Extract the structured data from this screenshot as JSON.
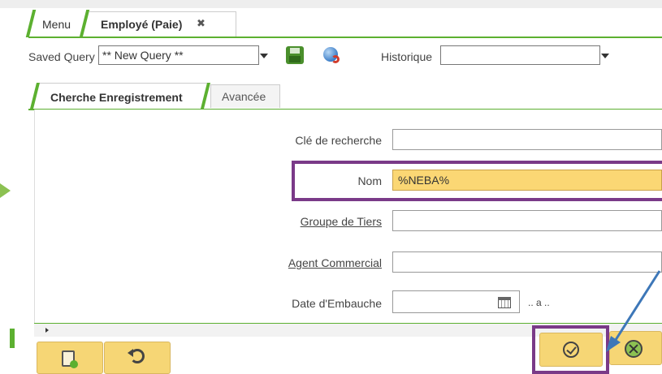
{
  "tabs": {
    "menu": "Menu",
    "employee": "Employé (Paie)",
    "close_glyph": "✖"
  },
  "toolbar": {
    "saved_query_label": "Saved Query",
    "saved_query_value": "** New Query **",
    "historique_label": "Historique",
    "historique_value": ""
  },
  "subtabs": {
    "search": "Cherche Enregistrement",
    "advanced": "Avancée"
  },
  "form": {
    "search_key_label": "Clé de recherche",
    "search_key_value": "",
    "name_label": "Nom",
    "name_value": "%NEBA%",
    "bp_group_label": "Groupe de Tiers",
    "bp_group_value": "",
    "sales_rep_label": "Agent Commercial",
    "sales_rep_value": "",
    "hire_date_label": "Date d'Embauche",
    "hire_date_value": "",
    "range_sep": ".. a .."
  },
  "colors": {
    "accent_green": "#5cb030",
    "highlight_purple": "#7a3a88",
    "button_yellow": "#f6d675",
    "name_field_bg": "#fbd774",
    "arrow_blue": "#3d77b8"
  }
}
